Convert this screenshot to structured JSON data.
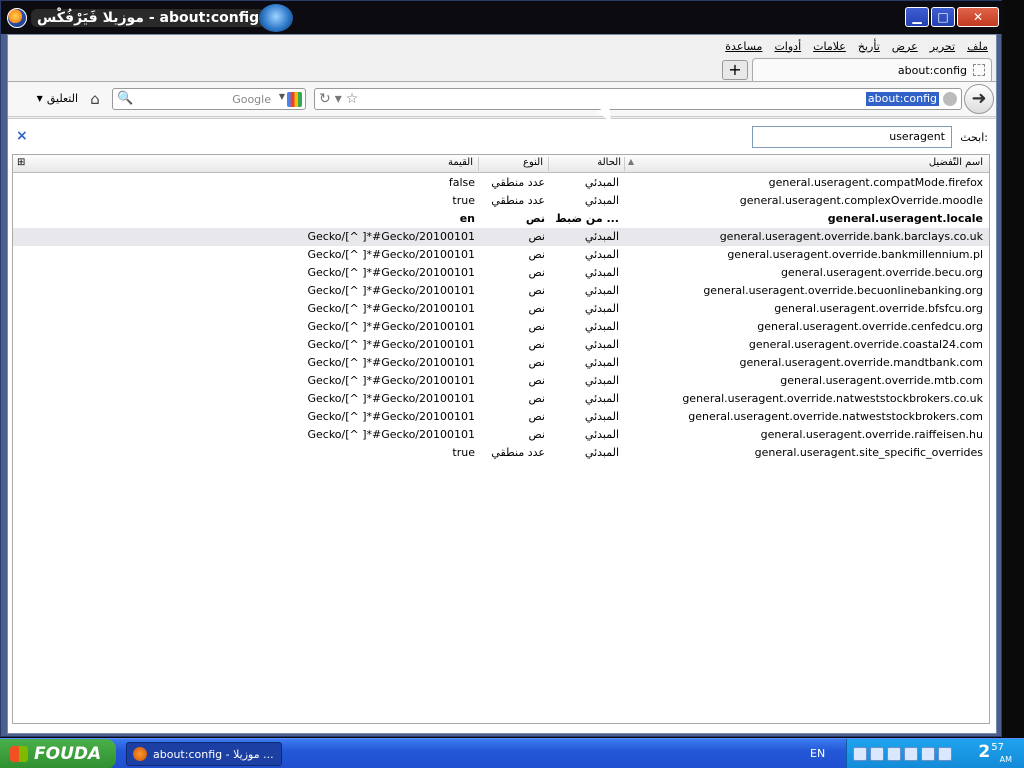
{
  "window": {
    "title": "موزيلا فَيَرْفُكْس - about:config",
    "controls": [
      "minimize",
      "maximize",
      "close"
    ]
  },
  "menubar": [
    "ملف",
    "تحرير",
    "عرض",
    "تأريخ",
    "علامات",
    "أدوات",
    "مساعدة"
  ],
  "tabs": {
    "active_label": "about:config",
    "new_tab_label": "+"
  },
  "navbar": {
    "url": "about:config",
    "search_placeholder": "Google",
    "feedback_label": "التعليق"
  },
  "filter": {
    "label": "ابحث:",
    "value": "useragent",
    "clear_label": "×"
  },
  "columns": {
    "name": "اسم التّفضيل",
    "status": "الحالة",
    "type": "النوع",
    "value": "القيمة"
  },
  "rows": [
    {
      "name": "general.useragent.compatMode.firefox",
      "status": "المبدئي",
      "type": "عدد منطقي",
      "value": "false"
    },
    {
      "name": "general.useragent.complexOverride.moodle",
      "status": "المبدئي",
      "type": "عدد منطقي",
      "value": "true"
    },
    {
      "name": "general.useragent.locale",
      "status": "من ضبط ...",
      "type": "نص",
      "value": "en",
      "bold": true
    },
    {
      "name": "general.useragent.override.bank.barclays.co.uk",
      "status": "المبدئي",
      "type": "نص",
      "value": "Gecko/[^ ]*#Gecko/20100101",
      "selected": true
    },
    {
      "name": "general.useragent.override.bankmillennium.pl",
      "status": "المبدئي",
      "type": "نص",
      "value": "Gecko/[^ ]*#Gecko/20100101"
    },
    {
      "name": "general.useragent.override.becu.org",
      "status": "المبدئي",
      "type": "نص",
      "value": "Gecko/[^ ]*#Gecko/20100101"
    },
    {
      "name": "general.useragent.override.becuonlinebanking.org",
      "status": "المبدئي",
      "type": "نص",
      "value": "Gecko/[^ ]*#Gecko/20100101"
    },
    {
      "name": "general.useragent.override.bfsfcu.org",
      "status": "المبدئي",
      "type": "نص",
      "value": "Gecko/[^ ]*#Gecko/20100101"
    },
    {
      "name": "general.useragent.override.cenfedcu.org",
      "status": "المبدئي",
      "type": "نص",
      "value": "Gecko/[^ ]*#Gecko/20100101"
    },
    {
      "name": "general.useragent.override.coastal24.com",
      "status": "المبدئي",
      "type": "نص",
      "value": "Gecko/[^ ]*#Gecko/20100101"
    },
    {
      "name": "general.useragent.override.mandtbank.com",
      "status": "المبدئي",
      "type": "نص",
      "value": "Gecko/[^ ]*#Gecko/20100101"
    },
    {
      "name": "general.useragent.override.mtb.com",
      "status": "المبدئي",
      "type": "نص",
      "value": "Gecko/[^ ]*#Gecko/20100101"
    },
    {
      "name": "general.useragent.override.natweststockbrokers.co.uk",
      "status": "المبدئي",
      "type": "نص",
      "value": "Gecko/[^ ]*#Gecko/20100101"
    },
    {
      "name": "general.useragent.override.natweststockbrokers.com",
      "status": "المبدئي",
      "type": "نص",
      "value": "Gecko/[^ ]*#Gecko/20100101"
    },
    {
      "name": "general.useragent.override.raiffeisen.hu",
      "status": "المبدئي",
      "type": "نص",
      "value": "Gecko/[^ ]*#Gecko/20100101"
    },
    {
      "name": "general.useragent.site_specific_overrides",
      "status": "المبدئي",
      "type": "عدد منطقي",
      "value": "true"
    }
  ],
  "taskbar": {
    "start_label": "FOUDA",
    "task_label": "about:config - موزيلا ...",
    "language": "EN",
    "clock_hour": "2",
    "clock_minute": "57",
    "clock_ampm": "AM"
  }
}
